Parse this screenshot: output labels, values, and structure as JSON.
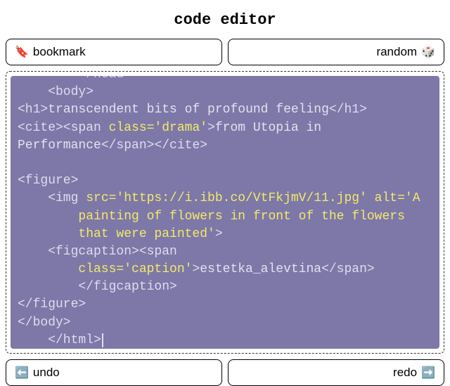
{
  "header": {
    "title": "code editor"
  },
  "buttons": {
    "bookmark": {
      "label": "bookmark",
      "icon": "🔖"
    },
    "random": {
      "label": "random",
      "icon": "🎲"
    },
    "undo": {
      "label": "undo",
      "icon": "⬅️"
    },
    "redo": {
      "label": "redo",
      "icon": "➡️"
    }
  },
  "code": {
    "lines": [
      {
        "indent": 3,
        "tokens": [
          {
            "t": "tag",
            "v": "</head>"
          }
        ],
        "clip": "top"
      },
      {
        "indent": 2,
        "tokens": [
          {
            "t": "tag",
            "v": "<body>"
          }
        ]
      },
      {
        "indent": 0,
        "tokens": [
          {
            "t": "tag",
            "v": "<h1>"
          },
          {
            "t": "text",
            "v": "transcendent bits of profound feeling"
          },
          {
            "t": "tag",
            "v": "</h1>"
          }
        ]
      },
      {
        "indent": 0,
        "tokens": [
          {
            "t": "tag",
            "v": "<cite><span "
          },
          {
            "t": "attr",
            "v": "class='drama'"
          },
          {
            "t": "tag",
            "v": ">"
          },
          {
            "t": "text",
            "v": "from Utopia in Performance"
          },
          {
            "t": "tag",
            "v": "</span></cite>"
          }
        ]
      },
      {
        "indent": 0,
        "tokens": []
      },
      {
        "indent": 0,
        "tokens": [
          {
            "t": "tag",
            "v": "<figure>"
          }
        ]
      },
      {
        "indent": 2,
        "tokens": [
          {
            "t": "tag",
            "v": "<img "
          },
          {
            "t": "attr",
            "v": "src='https://i.ibb.co/VtFkjmV/11.jpg' alt='A painting of flowers in front of the flowers that were painted'"
          },
          {
            "t": "tag",
            "v": ">"
          }
        ]
      },
      {
        "indent": 2,
        "tokens": [
          {
            "t": "tag",
            "v": "<figcaption><span "
          },
          {
            "t": "attr",
            "v": "class='caption'"
          },
          {
            "t": "tag",
            "v": ">"
          },
          {
            "t": "text",
            "v": "estetka_alevtina"
          },
          {
            "t": "tag",
            "v": "</span></figcaption>"
          }
        ]
      },
      {
        "indent": 0,
        "tokens": [
          {
            "t": "tag",
            "v": "</figure>"
          }
        ]
      },
      {
        "indent": 0,
        "tokens": [
          {
            "t": "tag",
            "v": "</body>"
          }
        ]
      },
      {
        "indent": 2,
        "tokens": [
          {
            "t": "tag",
            "v": "</html>"
          }
        ],
        "cursor": true
      }
    ]
  }
}
